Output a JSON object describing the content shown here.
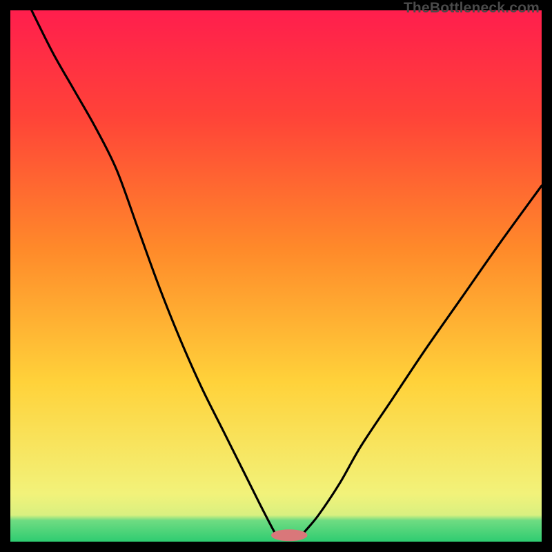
{
  "watermark": "TheBottleneck.com",
  "chart_data": {
    "type": "line",
    "title": "",
    "xlabel": "",
    "ylabel": "",
    "xlim": [
      0,
      100
    ],
    "ylim": [
      0,
      100
    ],
    "grid": false,
    "legend": false,
    "annotations": [],
    "background_gradient_stops": [
      {
        "pos": 0.0,
        "color": "#2ecc71"
      },
      {
        "pos": 0.04,
        "color": "#6fdc82"
      },
      {
        "pos": 0.05,
        "color": "#d9f080"
      },
      {
        "pos": 0.09,
        "color": "#f2f27a"
      },
      {
        "pos": 0.3,
        "color": "#ffd23a"
      },
      {
        "pos": 0.55,
        "color": "#ff8a2a"
      },
      {
        "pos": 0.8,
        "color": "#ff4338"
      },
      {
        "pos": 1.0,
        "color": "#ff1e4d"
      }
    ],
    "marker": {
      "cx": 52.5,
      "cy": 1.2,
      "rx": 3.4,
      "ry": 1.1,
      "fill": "#d9777a"
    },
    "series": [
      {
        "name": "left-curve",
        "x": [
          4,
          8,
          12,
          16,
          20,
          24,
          28,
          32,
          36,
          40,
          44,
          47,
          49.6,
          50.2
        ],
        "y": [
          100,
          92,
          85,
          78,
          70,
          59,
          48,
          38,
          29,
          21,
          13,
          7,
          2.0,
          1.2
        ]
      },
      {
        "name": "right-curve",
        "x": [
          54.8,
          55.5,
          58,
          62,
          66,
          72,
          78,
          85,
          92,
          100
        ],
        "y": [
          1.2,
          2.0,
          5,
          11,
          18,
          27,
          36,
          46,
          56,
          67
        ]
      }
    ]
  }
}
